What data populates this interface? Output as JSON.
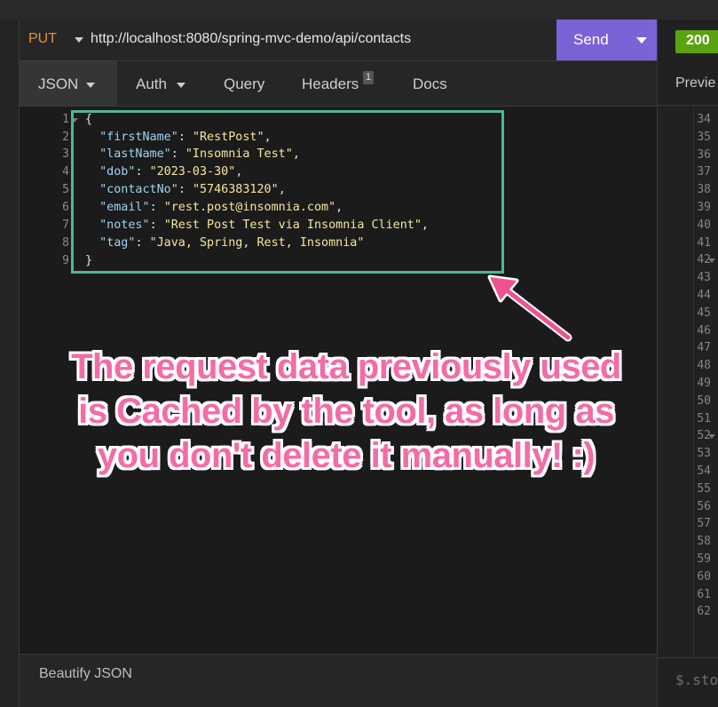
{
  "request": {
    "method": "PUT",
    "url": "http://localhost:8080/spring-mvc-demo/api/contacts",
    "send_label": "Send"
  },
  "response": {
    "status": "200",
    "tab_label": "Previe",
    "line_numbers": [
      "34",
      "35",
      "36",
      "37",
      "38",
      "39",
      "40",
      "41",
      "42",
      "43",
      "44",
      "45",
      "46",
      "47",
      "48",
      "49",
      "50",
      "51",
      "52",
      "53",
      "54",
      "55",
      "56",
      "57",
      "58",
      "59",
      "60",
      "61",
      "62"
    ],
    "filter_placeholder": "$.sto"
  },
  "tabs": [
    {
      "label": "JSON"
    },
    {
      "label": "Auth"
    },
    {
      "label": "Query"
    },
    {
      "label": "Headers",
      "badge": "1"
    },
    {
      "label": "Docs"
    }
  ],
  "editor": {
    "line_numbers": [
      "1",
      "2",
      "3",
      "4",
      "5",
      "6",
      "7",
      "8",
      "9"
    ],
    "lines": [
      {
        "open": "{"
      },
      {
        "key": "\"firstName\"",
        "value": "\"RestPost\""
      },
      {
        "key": "\"lastName\"",
        "value": "\"Insomnia Test\""
      },
      {
        "key": "\"dob\"",
        "value": "\"2023-03-30\""
      },
      {
        "key": "\"contactNo\"",
        "value": "\"5746383120\""
      },
      {
        "key": "\"email\"",
        "value": "\"rest.post@insomnia.com\""
      },
      {
        "key": "\"notes\"",
        "value": "\"Rest Post Test via Insomnia Client\""
      },
      {
        "key": "\"tag\"",
        "value": "\"Java, Spring, Rest, Insomnia\""
      },
      {
        "close": "}"
      }
    ]
  },
  "bottom": {
    "beautify_label": "Beautify JSON"
  },
  "annotation": {
    "line1": "The request data previously used",
    "line2": "is Cached by the tool, as long as",
    "line3": "you don't delete it manually! :)",
    "colors": {
      "text": "#f36ca7",
      "outline": "#ffffff",
      "box": "#4fb69a",
      "arrow": "#f0528f"
    }
  },
  "colors": {
    "send_button": "#7b62d6",
    "status_ok": "#59a210",
    "method": "#e8913a"
  }
}
